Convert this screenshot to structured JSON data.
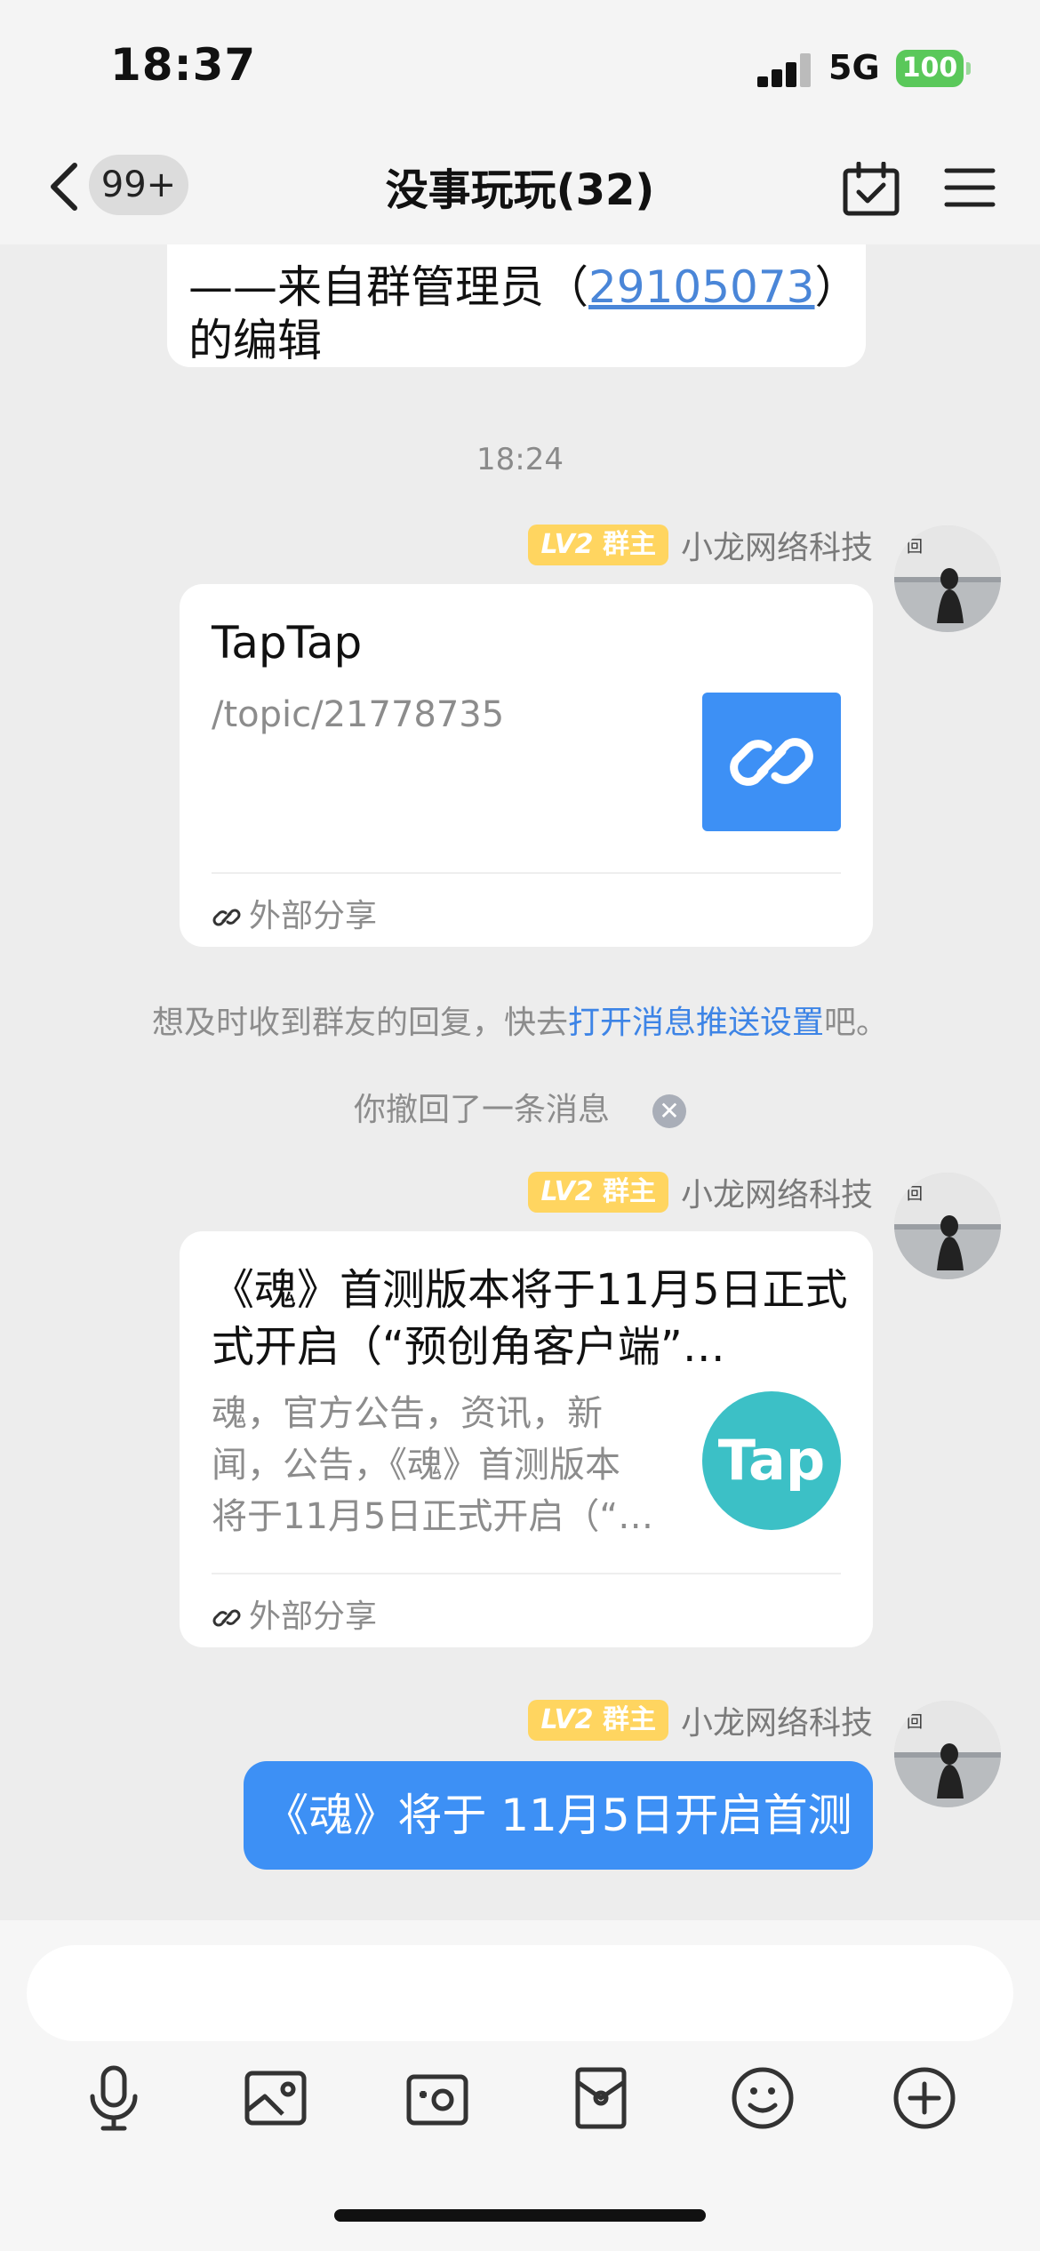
{
  "status_bar": {
    "time": "18:37",
    "network": "5G",
    "battery": "100"
  },
  "nav": {
    "unread": "99+",
    "title": "没事玩玩(32)"
  },
  "messages": {
    "prev_note": {
      "prefix": "——来自群管理员（",
      "id": "29105073",
      "suffix": "）",
      "line2": "的编辑"
    },
    "timestamp": "18:24",
    "sender": {
      "lv": "LV2",
      "role": "群主",
      "name": "小龙网络科技"
    },
    "card1": {
      "title": "TapTap",
      "desc": "/topic/21778735",
      "footer": "外部分享"
    },
    "push_tip": {
      "prefix": "想及时收到群友的回复，快去",
      "link": "打开消息推送设置",
      "suffix": "吧。"
    },
    "recall": "你撤回了一条消息",
    "card2": {
      "title_line1": "《魂》首测版本将于11月5日正式",
      "title_line2": "式开启（“预创角客户端”…",
      "desc_line1": "魂，官方公告，资讯，新",
      "desc_line2": "闻，公告，《魂》首测版本",
      "desc_line3": "将于11月5日正式开启（“…",
      "thumb_text": "Tap",
      "footer": "外部分享"
    },
    "text_msg": "《魂》将于 11月5日开启首测"
  },
  "colors": {
    "accent": "#3d90f5",
    "link": "#4a86d8",
    "badge": "#ffd560",
    "taptap_teal": "#3cc0c6"
  }
}
